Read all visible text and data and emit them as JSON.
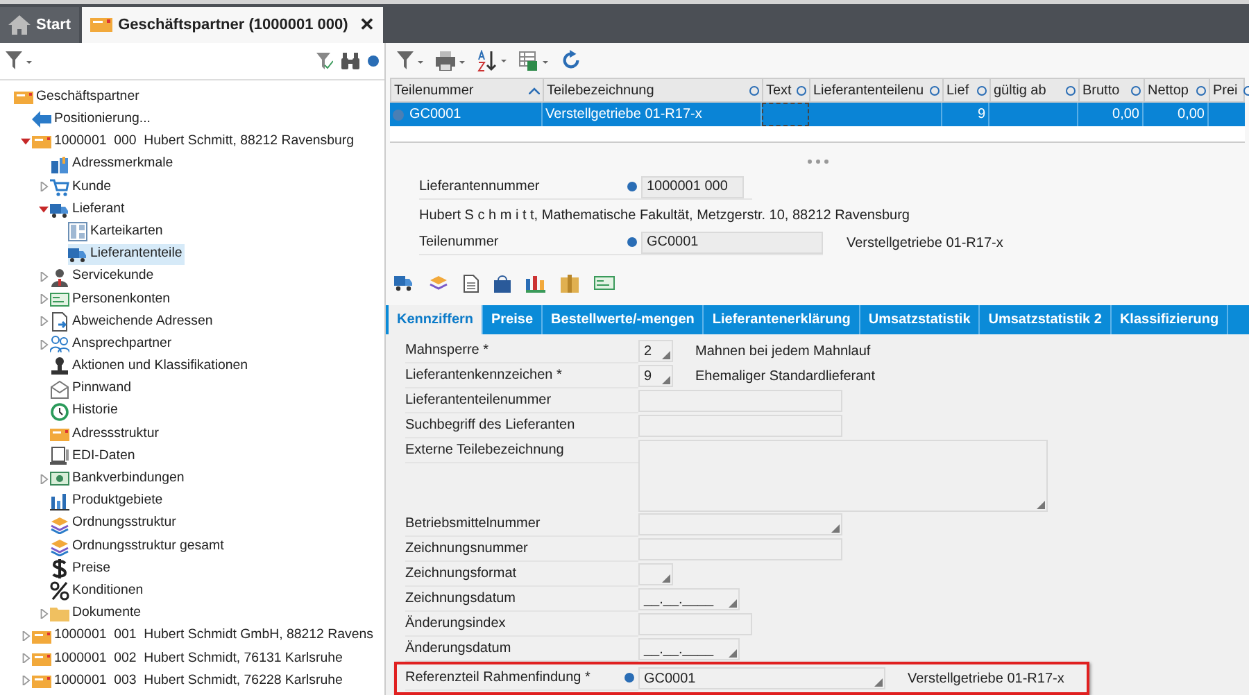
{
  "header_tabs": [
    {
      "label": "Start",
      "kind": "home",
      "selected": false
    },
    {
      "label": "Geschäftspartner (1000001 000)",
      "kind": "partner",
      "selected": true,
      "close": "✕"
    }
  ],
  "tree": [
    {
      "label": "Geschäftspartner",
      "kind": "partner",
      "selected": false,
      "children": [
        {
          "label": "Positionierung...",
          "kind": "arrow",
          "selected": false
        },
        {
          "label": "1000001  000  Hubert Schmitt, 88212 Ravensburg",
          "kind": "partner",
          "expanded": true,
          "selected": false,
          "children": [
            {
              "label": "Adressmerkmale",
              "kind": "book",
              "selected": false
            },
            {
              "label": "Kunde",
              "kind": "cart",
              "expanded": false,
              "selected": false
            },
            {
              "label": "Lieferant",
              "kind": "truck",
              "expanded": true,
              "selected": false,
              "children": [
                {
                  "label": "Karteikarten",
                  "kind": "cards",
                  "selected": false
                },
                {
                  "label": "Lieferantenteile",
                  "kind": "truck",
                  "selected": true
                }
              ]
            },
            {
              "label": "Servicekunde",
              "kind": "person",
              "expanded": false,
              "selected": false
            },
            {
              "label": "Personenkonten",
              "kind": "card",
              "expanded": false,
              "selected": false
            },
            {
              "label": "Abweichende Adressen",
              "kind": "doc",
              "expanded": false,
              "selected": false
            },
            {
              "label": "Ansprechpartner",
              "kind": "people",
              "expanded": false,
              "selected": false
            },
            {
              "label": "Aktionen und Klassifikationen",
              "kind": "stamp",
              "selected": false
            },
            {
              "label": "Pinnwand",
              "kind": "mail",
              "selected": false
            },
            {
              "label": "Historie",
              "kind": "clock",
              "selected": false
            },
            {
              "label": "Adressstruktur",
              "kind": "partner",
              "selected": false
            },
            {
              "label": "EDI-Daten",
              "kind": "computer",
              "selected": false
            },
            {
              "label": "Bankverbindungen",
              "kind": "bank",
              "expanded": false,
              "selected": false
            },
            {
              "label": "Produktgebiete",
              "kind": "bars",
              "selected": false
            },
            {
              "label": "Ordnungsstruktur",
              "kind": "layers",
              "selected": false
            },
            {
              "label": "Ordnungsstruktur gesamt",
              "kind": "layers",
              "selected": false
            },
            {
              "label": "Preise",
              "kind": "dollar",
              "selected": false
            },
            {
              "label": "Konditionen",
              "kind": "percent",
              "selected": false
            },
            {
              "label": "Dokumente",
              "kind": "folder",
              "expanded": false,
              "selected": false
            }
          ]
        },
        {
          "label": "1000001  001  Hubert Schmidt GmbH, 88212 Ravens",
          "kind": "partner",
          "expanded": false,
          "selected": false
        },
        {
          "label": "1000001  002  Hubert Schmidt, 76131 Karlsruhe",
          "kind": "partner",
          "expanded": false,
          "selected": false
        },
        {
          "label": "1000001  003  Hubert Schmidt, 76228 Karlsruhe",
          "kind": "partner",
          "expanded": false,
          "selected": false
        }
      ]
    }
  ],
  "table": {
    "columns": [
      {
        "label": "Teilenummer",
        "sorted": true
      },
      {
        "label": "Teilebezeichnung",
        "sorted": false
      },
      {
        "label": "Text",
        "sorted": false
      },
      {
        "label": "Lieferantenteilenu",
        "sorted": false
      },
      {
        "label": "Lief",
        "sorted": false
      },
      {
        "label": "gültig ab",
        "sorted": false
      },
      {
        "label": "Brutto",
        "sorted": false
      },
      {
        "label": "Nettop",
        "sorted": false
      },
      {
        "label": "Prei",
        "sorted": false
      }
    ],
    "rows": [
      {
        "selected": true,
        "cells": [
          "GC0001",
          "Verstellgetriebe 01-R17-x",
          "",
          "",
          "9",
          "",
          "0,00",
          "0,00",
          ""
        ]
      }
    ]
  },
  "detail": {
    "supplier_label": "Lieferantennummer",
    "supplier_value": "1000001 000",
    "address": "Hubert S c h m i t t, Mathematische Fakultät, Metzgerstr. 10, 88212 Ravensburg",
    "part_label": "Teilenummer",
    "part_value": "GC0001",
    "part_description": "Verstellgetriebe 01-R17-x"
  },
  "tabs": [
    {
      "label": "Kennziffern",
      "selected": true
    },
    {
      "label": "Preise",
      "selected": false
    },
    {
      "label": "Bestellwerte/-mengen",
      "selected": false
    },
    {
      "label": "Lieferantenerklärung",
      "selected": false
    },
    {
      "label": "Umsatzstatistik",
      "selected": false
    },
    {
      "label": "Umsatzstatistik 2",
      "selected": false
    },
    {
      "label": "Klassifizierung",
      "selected": false
    }
  ],
  "fields": [
    {
      "label": "Mahnsperre *",
      "kind": "tiny",
      "value": "2",
      "description": "Mahnen bei jedem Mahnlauf"
    },
    {
      "label": "Lieferantenkennzeichen *",
      "kind": "tiny",
      "value": "9",
      "description": "Ehemaliger Standardlieferant"
    },
    {
      "label": "Lieferantenteilenummer",
      "kind": "text"
    },
    {
      "label": "Suchbegriff des Lieferanten",
      "kind": "text"
    },
    {
      "label": "Externe Teilebezeichnung",
      "kind": "area"
    },
    {
      "label": "Betriebsmittelnummer",
      "kind": "select"
    },
    {
      "label": "Zeichnungsnummer",
      "kind": "text"
    },
    {
      "label": "Zeichnungsformat",
      "kind": "tiny"
    },
    {
      "label": "Zeichnungsdatum",
      "kind": "date",
      "value": "__.__.____"
    },
    {
      "label": "Änderungsindex",
      "kind": "short"
    },
    {
      "label": "Änderungsdatum",
      "kind": "date",
      "value": "__.__.____"
    },
    {
      "label": "Referenzteil Rahmenfindung *",
      "kind": "select",
      "info": true,
      "highlighted": true,
      "value": "GC0001",
      "description": "Verstellgetriebe 01-R17-x"
    }
  ]
}
